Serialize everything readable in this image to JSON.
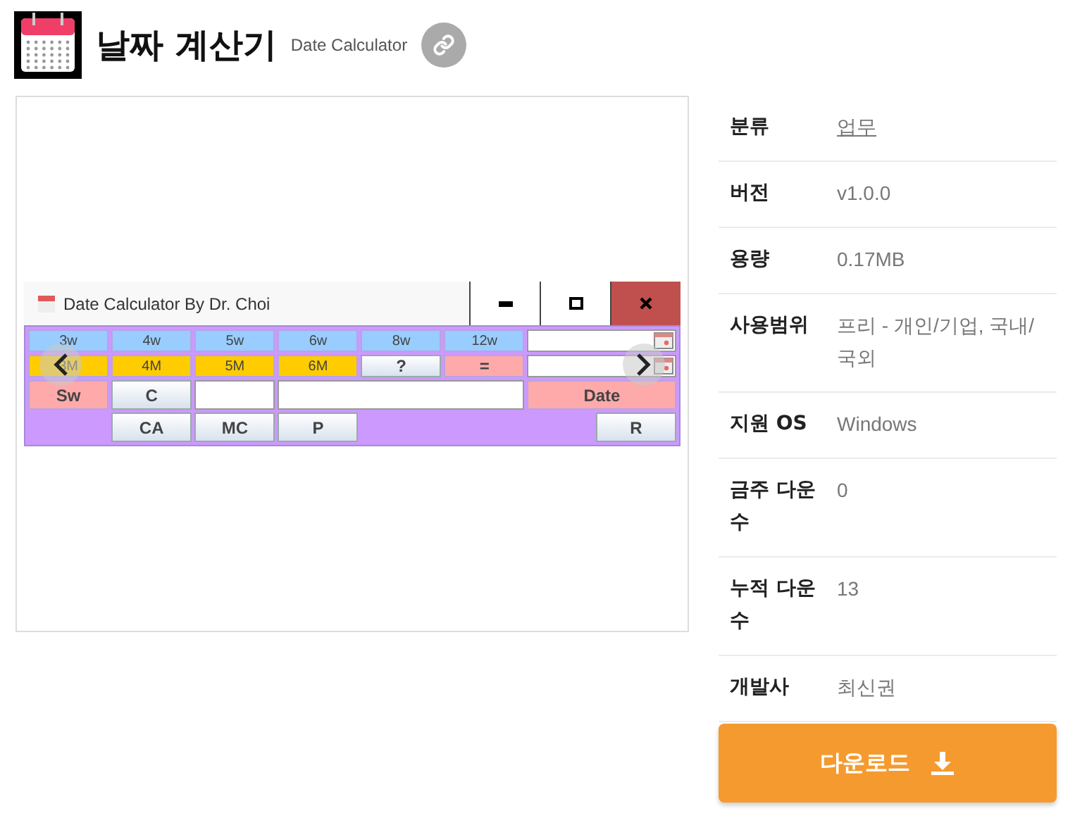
{
  "header": {
    "title": "날짜 계산기",
    "subtitle": "Date Calculator"
  },
  "preview": {
    "window_title": "Date Calculator By Dr. Choi",
    "rows": [
      [
        {
          "kind": "week",
          "label": "3w"
        },
        {
          "kind": "week",
          "label": "4w"
        },
        {
          "kind": "week",
          "label": "5w"
        },
        {
          "kind": "week",
          "label": "6w"
        },
        {
          "kind": "week",
          "label": "8w"
        },
        {
          "kind": "week",
          "label": "12w"
        },
        {
          "kind": "date-field"
        }
      ],
      [
        {
          "kind": "month",
          "label": "3M"
        },
        {
          "kind": "month",
          "label": "4M"
        },
        {
          "kind": "month",
          "label": "5M"
        },
        {
          "kind": "month",
          "label": "6M"
        },
        {
          "kind": "key",
          "label": "?"
        },
        {
          "kind": "op",
          "label": "="
        },
        {
          "kind": "date-field"
        }
      ],
      [
        {
          "kind": "op",
          "label": "Sw"
        },
        {
          "kind": "key",
          "label": "C"
        },
        {
          "kind": "field"
        },
        {
          "kind": "wide-field"
        },
        {
          "kind": "op",
          "label": "Date"
        }
      ],
      [
        {
          "kind": "blank"
        },
        {
          "kind": "key",
          "label": "CA"
        },
        {
          "kind": "key",
          "label": "MC"
        },
        {
          "kind": "key",
          "label": "P"
        },
        {
          "kind": "wide-blank"
        },
        {
          "kind": "short-key",
          "label": "R"
        }
      ]
    ]
  },
  "info": [
    {
      "label": "분류",
      "value": "업무",
      "kind": "link"
    },
    {
      "label": "버전",
      "value": "v1.0.0",
      "kind": "text"
    },
    {
      "label": "용량",
      "value": "0.17MB",
      "kind": "text"
    },
    {
      "label": "사용범위",
      "value": "프리 - 개인/기업, 국내/국외",
      "kind": "text"
    },
    {
      "label": "지원 OS",
      "value": "Windows",
      "kind": "text"
    },
    {
      "label": "금주 다운수",
      "value": "0",
      "kind": "text"
    },
    {
      "label": "누적 다운수",
      "value": "13",
      "kind": "text"
    },
    {
      "label": "개발사",
      "value": "최신권",
      "kind": "text"
    }
  ],
  "download_button": "다운로드"
}
